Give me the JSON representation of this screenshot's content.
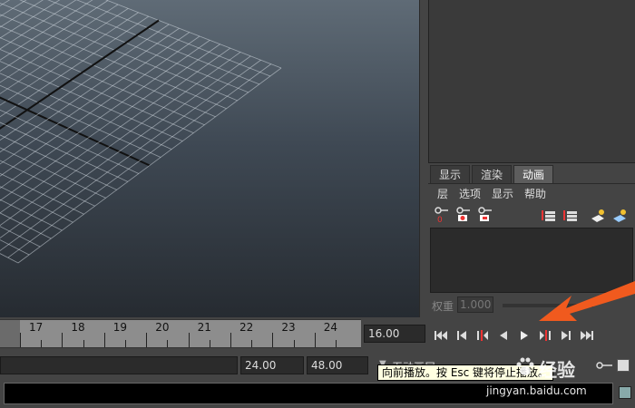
{
  "panel_tabs": [
    {
      "label": "显示",
      "active": false
    },
    {
      "label": "渲染",
      "active": false
    },
    {
      "label": "动画",
      "active": true
    }
  ],
  "layer_menu": [
    "层",
    "选项",
    "显示",
    "帮助"
  ],
  "layer_icons": [
    "key-red-icon",
    "key-red-circle-icon",
    "key-red-box-icon",
    "layers-up-icon",
    "layers-down-icon",
    "layer-new-icon",
    "layer-selected-icon"
  ],
  "weight": {
    "label": "权重",
    "value": "1.000"
  },
  "timeline": {
    "visible_frames": [
      "17",
      "18",
      "19",
      "20",
      "21",
      "22",
      "23",
      "24"
    ]
  },
  "current_frame": "16.00",
  "transport_icons": [
    "go-to-start-icon",
    "step-back-icon",
    "step-back-key-icon",
    "play-backward-icon",
    "play-forward-icon",
    "step-forward-key-icon",
    "step-forward-icon",
    "go-to-end-icon"
  ],
  "range": {
    "end_time": "24.00",
    "playback_end": "48.00",
    "anim_layer_label": "无动画层"
  },
  "tooltip": "向前播放。按 Esc 键将停止播放。",
  "watermark": {
    "text": "经验",
    "url": "jingyan.baidu.com"
  },
  "colors": {
    "annotation_arrow": "#f05a1e",
    "tooltip_bg": "#ffffe1",
    "timeline_bg": "#8d8d8d"
  }
}
